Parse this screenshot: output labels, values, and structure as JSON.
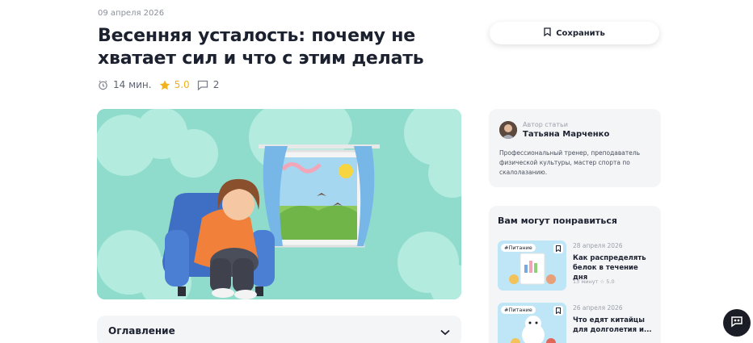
{
  "article": {
    "date": "09 апреля 2026",
    "title": "Весенняя усталость: почему не хватает сил и что с этим делать",
    "read_time": "14 мин.",
    "rating": "5.0",
    "comments": "2",
    "toc_label": "Оглавление"
  },
  "actions": {
    "save_label": "Сохранить"
  },
  "author": {
    "caption": "Автор статьи",
    "name": "Татьяна Марченко",
    "bio": "Профессиональный тренер, преподаватель физической культуры, мастер спорта по скалолазанию."
  },
  "recommendations": {
    "heading": "Вам могут понравиться",
    "items": [
      {
        "tag": "#Питание",
        "date": "28 апреля 2026",
        "title": "Как распределять белок в течение дня",
        "meta": "13 минут  ☆ 5.0"
      },
      {
        "tag": "#Питание",
        "date": "26 апреля 2026",
        "title": "Что едят китайцы для долголетия и...",
        "meta": ""
      }
    ]
  },
  "colors": {
    "accent_star": "#f1b21a",
    "hero_bg": "#8fdccd",
    "panel_bg": "#f4f5f7"
  },
  "icons": [
    "alarm-clock-icon",
    "star-icon",
    "comment-icon",
    "bookmark-icon",
    "chevron-down-icon",
    "chat-icon"
  ]
}
